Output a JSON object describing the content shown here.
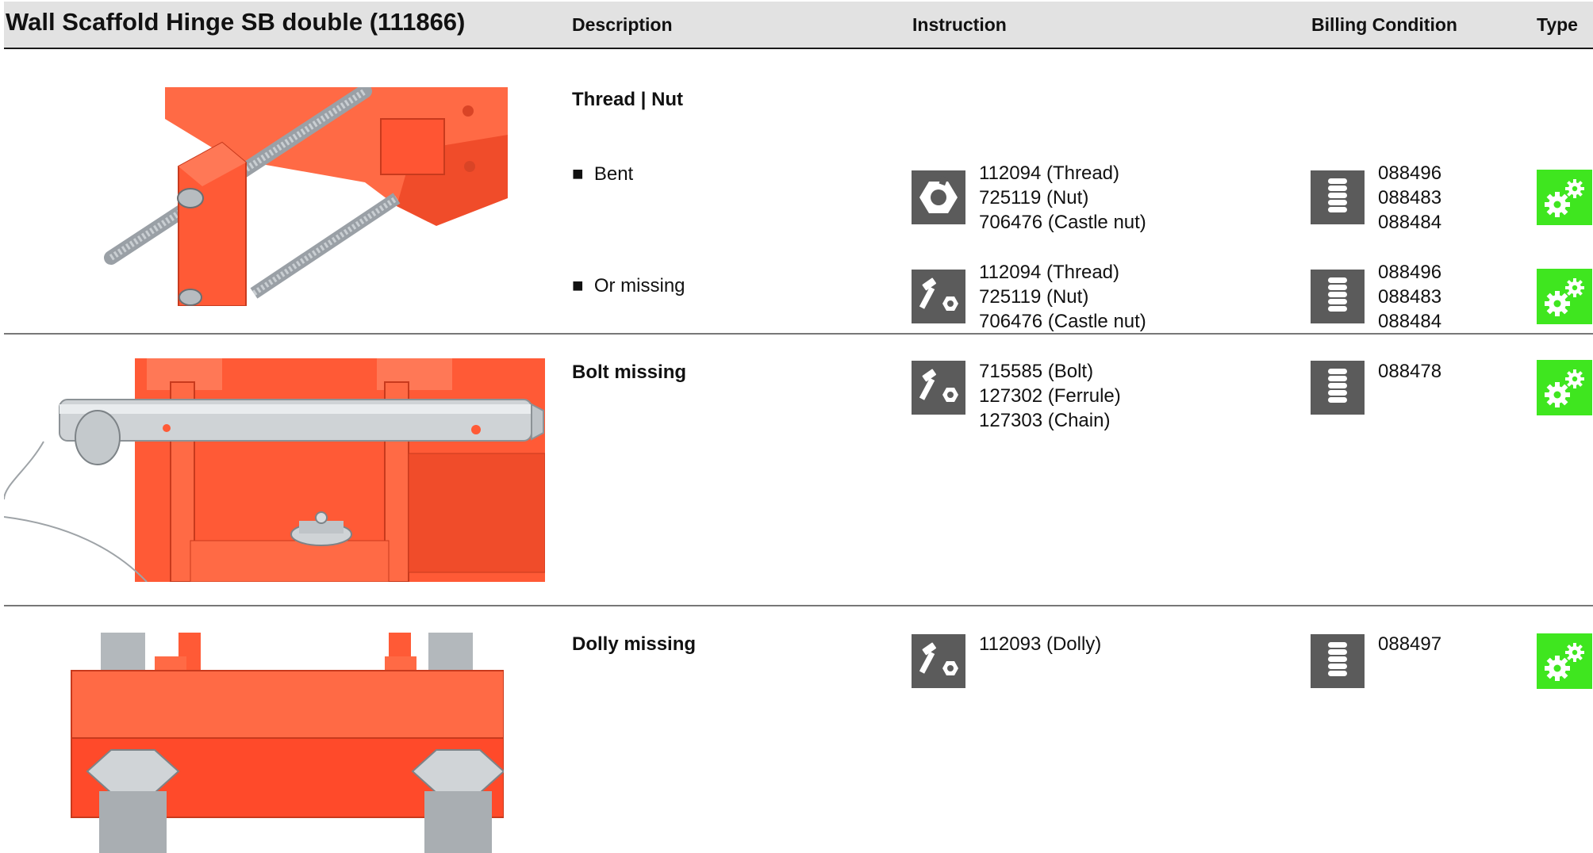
{
  "header": {
    "title": "Wall Scaffold Hinge SB double (111866)",
    "description": "Description",
    "instruction": "Instruction",
    "billing": "Billing Condition",
    "type": "Type"
  },
  "sections": [
    {
      "heading": "Thread | Nut",
      "items": [
        {
          "bullet": "■",
          "label": "Bent",
          "instruction_icon": "nut-icon",
          "instructions": [
            "112094 (Thread)",
            "725119 (Nut)",
            "706476 (Castle nut)"
          ],
          "billing_icon": "coin-stack-icon",
          "billing": [
            "088496",
            "088483",
            "088484"
          ],
          "type_icon": "gears-icon"
        },
        {
          "bullet": "■",
          "label": "Or missing",
          "instruction_icon": "bolt-nut-icon",
          "instructions": [
            "112094 (Thread)",
            "725119 (Nut)",
            "706476 (Castle nut)"
          ],
          "billing_icon": "coin-stack-icon",
          "billing": [
            "088496",
            "088483",
            "088484"
          ],
          "type_icon": "gears-icon"
        }
      ]
    },
    {
      "heading": "Bolt missing",
      "instruction_icon": "bolt-nut-icon",
      "instructions": [
        "715585 (Bolt)",
        "127302 (Ferrule)",
        "127303 (Chain)"
      ],
      "billing_icon": "coin-stack-icon",
      "billing": [
        "088478"
      ],
      "type_icon": "gears-icon"
    },
    {
      "heading": "Dolly missing",
      "instruction_icon": "bolt-nut-icon",
      "instructions": [
        "112093 (Dolly)"
      ],
      "billing_icon": "coin-stack-icon",
      "billing": [
        "088497"
      ],
      "type_icon": "gears-icon"
    }
  ],
  "colors": {
    "part_red": "#ff5a36",
    "header_bg": "#e2e2e2",
    "icon_grey": "#5b5b5b",
    "type_green": "#3fe61f"
  }
}
